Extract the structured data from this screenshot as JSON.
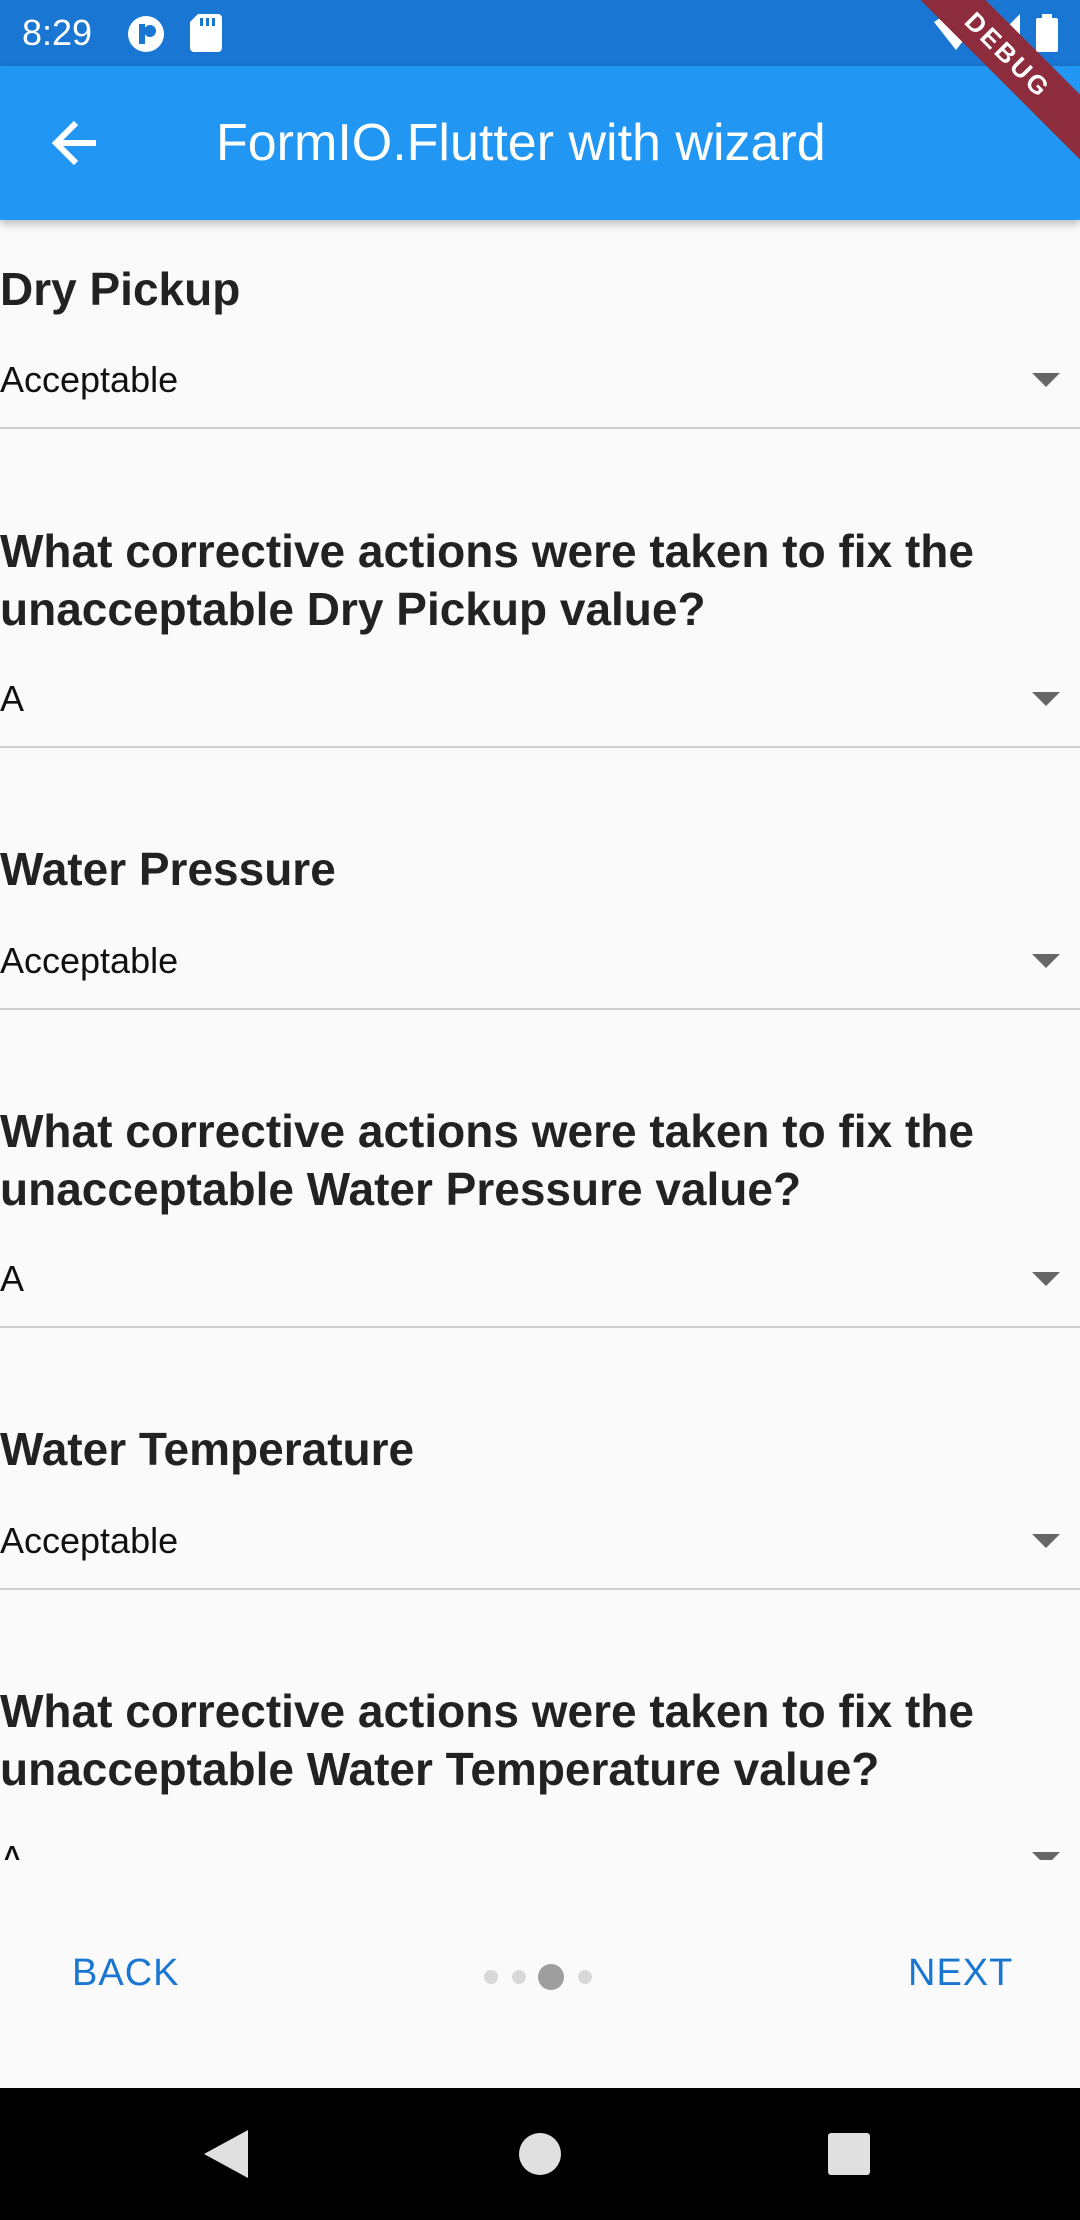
{
  "status_bar": {
    "time": "8:29",
    "icons": [
      "app-notification-icon",
      "sd-card-icon",
      "wifi-icon",
      "signal-icon",
      "battery-icon"
    ],
    "debug_label": "DEBUG"
  },
  "app_bar": {
    "title": "FormIO.Flutter with wizard",
    "back_icon": "arrow-back-icon",
    "color": "#2196f3"
  },
  "form": {
    "fields": [
      {
        "label": "Dry Pickup",
        "value": "Acceptable"
      },
      {
        "label": "What corrective actions were taken to fix the unacceptable Dry Pickup value?",
        "value": "A"
      },
      {
        "label": "Water Pressure",
        "value": "Acceptable"
      },
      {
        "label": "What corrective actions were taken to fix the unacceptable Water Pressure value?",
        "value": "A"
      },
      {
        "label": "Water Temperature",
        "value": "Acceptable"
      },
      {
        "label": "What corrective actions were taken to fix the unacceptable Water Temperature value?",
        "value": "A"
      }
    ]
  },
  "wizard": {
    "back_label": "BACK",
    "next_label": "NEXT",
    "total_pages": 4,
    "current_page": 3,
    "accent": "#1976d2"
  },
  "system_nav": {
    "buttons": [
      "back-triangle-icon",
      "home-circle-icon",
      "recents-square-icon"
    ]
  }
}
